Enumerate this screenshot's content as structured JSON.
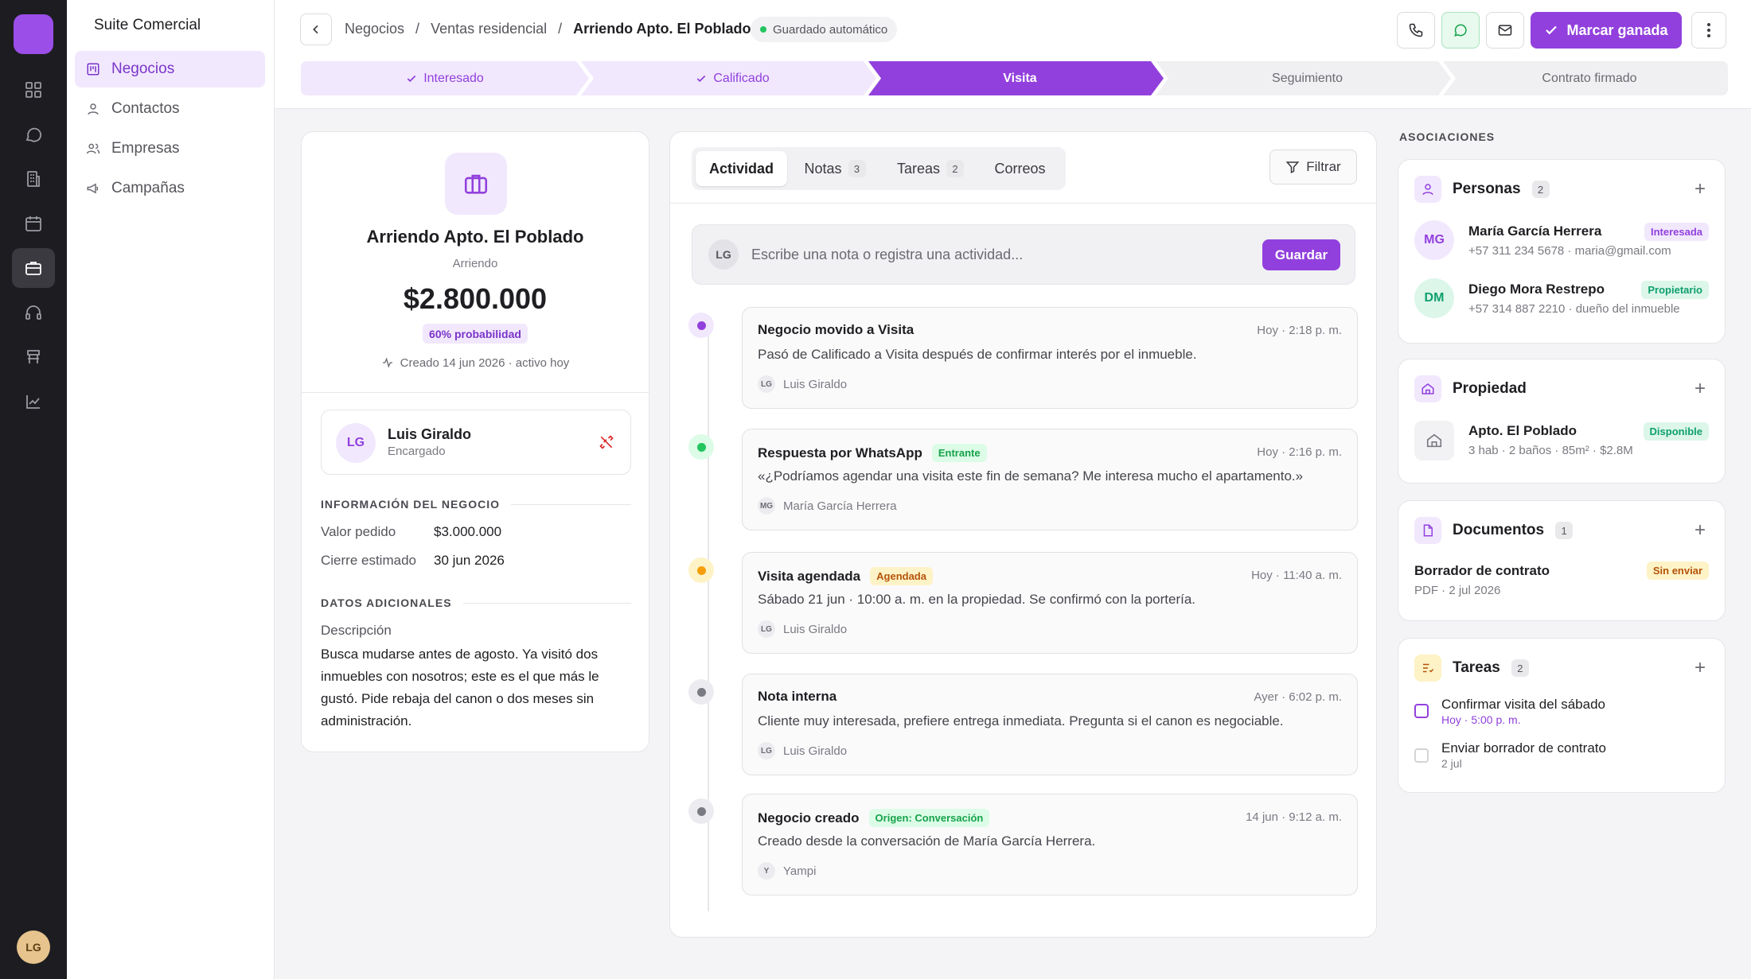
{
  "app": {
    "title": "Suite Comercial",
    "user_initials": "LG"
  },
  "sidebar": {
    "items": [
      {
        "label": "Negocios",
        "icon": "kanban-icon",
        "active": true
      },
      {
        "label": "Contactos",
        "icon": "user-icon"
      },
      {
        "label": "Empresas",
        "icon": "users-icon"
      },
      {
        "label": "Campañas",
        "icon": "megaphone-icon"
      }
    ]
  },
  "rail": {
    "icons": [
      "grid-icon",
      "chat-icon",
      "building-icon",
      "calendar-icon",
      "briefcase-icon",
      "headset-icon",
      "store-icon",
      "chart-icon"
    ]
  },
  "breadcrumb": {
    "items": [
      "Negocios",
      "Ventas residencial"
    ],
    "current": "Arriendo Apto. El Poblado",
    "sep": "/"
  },
  "saved": "Guardado automático",
  "actions": {
    "win": "Marcar ganada"
  },
  "stages": [
    {
      "label": "Interesado",
      "state": "done"
    },
    {
      "label": "Calificado",
      "state": "done"
    },
    {
      "label": "Visita",
      "state": "current"
    },
    {
      "label": "Seguimiento",
      "state": "todo"
    },
    {
      "label": "Contrato firmado",
      "state": "todo"
    }
  ],
  "deal": {
    "title": "Arriendo Apto. El Poblado",
    "type": "Arriendo",
    "amount": "$2.800.000",
    "probability": "60% probabilidad",
    "created": "Creado 14 jun 2026 · activo hoy",
    "owner": {
      "initials": "LG",
      "name": "Luis Giraldo",
      "role": "Encargado"
    },
    "info_title": "INFORMACIÓN DEL NEGOCIO",
    "info": [
      {
        "label": "Valor pedido",
        "value": "$3.000.000"
      },
      {
        "label": "Cierre estimado",
        "value": "30 jun 2026"
      }
    ],
    "extra_title": "DATOS ADICIONALES",
    "desc_label": "Descripción",
    "desc": "Busca mudarse antes de agosto. Ya visitó dos inmuebles con nosotros; este es el que más le gustó. Pide rebaja del canon o dos meses sin administración."
  },
  "activity": {
    "tabs": [
      {
        "label": "Actividad"
      },
      {
        "label": "Notas",
        "count": "3"
      },
      {
        "label": "Tareas",
        "count": "2"
      },
      {
        "label": "Correos"
      }
    ],
    "filter": "Filtrar",
    "composer": {
      "initials": "LG",
      "placeholder": "Escribe una nota o registra una actividad...",
      "save": "Guardar"
    },
    "events": [
      {
        "title": "Negocio movido a Visita",
        "time": "Hoy · 2:18 p. m.",
        "desc": "Pasó de Calificado a Visita después de confirmar interés por el inmueble.",
        "by": "Luis Giraldo",
        "by_initials": "LG",
        "color": "#9240dd",
        "bg": "#f1e8fd"
      },
      {
        "title": "Respuesta por WhatsApp",
        "tag": "Entrante",
        "tag_color": "#16a34a",
        "tag_bg": "#dcfce7",
        "time": "Hoy · 2:16 p. m.",
        "desc": "«¿Podríamos agendar una visita este fin de semana? Me interesa mucho el apartamento.»",
        "by": "María García Herrera",
        "by_initials": "MG",
        "color": "#22c55e",
        "bg": "#dcfce7"
      },
      {
        "title": "Visita agendada",
        "tag": "Agendada",
        "tag_color": "#b45309",
        "tag_bg": "#fef3c7",
        "time": "Hoy · 11:40 a. m.",
        "desc": "Sábado 21 jun · 10:00 a. m. en la propiedad. Se confirmó con la portería.",
        "by": "Luis Giraldo",
        "by_initials": "LG",
        "color": "#f59e0b",
        "bg": "#fef3c7"
      },
      {
        "title": "Nota interna",
        "time": "Ayer · 6:02 p. m.",
        "desc": "Cliente muy interesada, prefiere entrega inmediata. Pregunta si el canon es negociable.",
        "by": "Luis Giraldo",
        "by_initials": "LG",
        "color": "#7a7a82",
        "bg": "#ececf0"
      },
      {
        "title": "Negocio creado",
        "tag": "Origen: Conversación",
        "tag_color": "#16a34a",
        "tag_bg": "#dcfce7",
        "time": "14 jun · 9:12 a. m.",
        "desc": "Creado desde la conversación de María García Herrera.",
        "by": "Yampi",
        "by_initials": "Y",
        "color": "#7a7a82",
        "bg": "#ececf0"
      }
    ]
  },
  "assoc": {
    "title": "ASOCIACIONES",
    "people": {
      "title": "Personas",
      "count": "2",
      "items": [
        {
          "initials": "MG",
          "name": "María García Herrera",
          "tag": "Interesada",
          "meta": "+57 311 234 5678 · maria@gmail.com"
        },
        {
          "initials": "DM",
          "name": "Diego Mora Restrepo",
          "tag": "Propietario",
          "meta": "+57 314 887 2210 · dueño del inmueble"
        }
      ]
    },
    "property": {
      "title": "Propiedad",
      "name": "Apto. El Poblado",
      "tag": "Disponible",
      "meta": "3 hab · 2 baños · 85m² · $2.8M"
    },
    "docs": {
      "title": "Documentos",
      "count": "1",
      "name": "Borrador de contrato",
      "tag": "Sin enviar",
      "meta": "PDF · 2 jul 2026"
    },
    "tasks": {
      "title": "Tareas",
      "count": "2",
      "items": [
        {
          "name": "Confirmar visita del sábado",
          "due": "Hoy · 5:00 p. m."
        },
        {
          "name": "Enviar borrador de contrato",
          "due": "2 jul"
        }
      ]
    }
  },
  "colors": {
    "accent": "#9240dd",
    "accent_light": "#f1e8fd",
    "sidebar_dark": "#1d1d21"
  }
}
